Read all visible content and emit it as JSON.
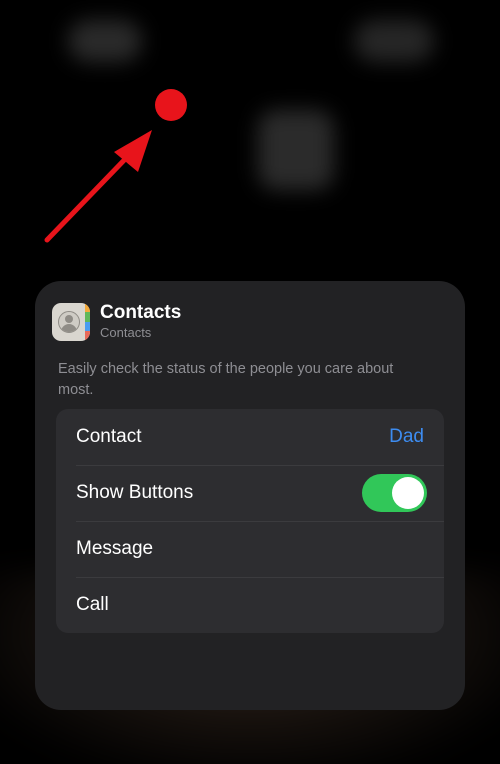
{
  "widget": {
    "title": "Contacts",
    "subtitle": "Contacts",
    "description": "Easily check the status of the people you care about most.",
    "settings": {
      "contact": {
        "label": "Contact",
        "value": "Dad"
      },
      "show_buttons": {
        "label": "Show Buttons",
        "enabled": true
      },
      "message": {
        "label": "Message"
      },
      "call": {
        "label": "Call"
      }
    }
  },
  "colors": {
    "accent": "#3d8cf0",
    "toggle_on": "#31c759",
    "annotation": "#e8141b",
    "icon_tabs": [
      "#f2a93b",
      "#5fb85a",
      "#4a9df0",
      "#e86a5a"
    ]
  },
  "icons": {
    "app_icon": "contacts-app-icon",
    "annotation": "red-pointer-arrow"
  }
}
